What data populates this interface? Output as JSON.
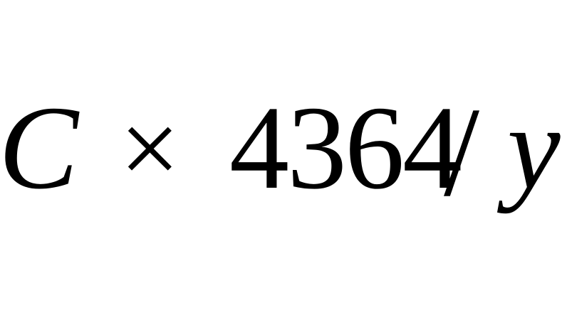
{
  "expression": {
    "variable": "C",
    "operator": "×",
    "number": "4364",
    "slash": "/",
    "divisor": "y"
  }
}
